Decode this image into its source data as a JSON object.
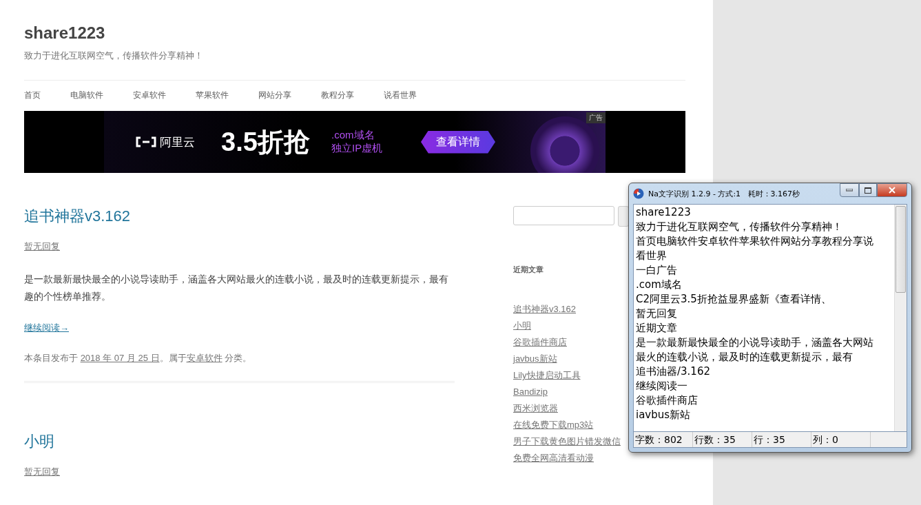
{
  "site": {
    "title": "share1223",
    "tagline": "致力于进化互联网空气，传播软件分享精神！"
  },
  "nav": [
    "首页",
    "电脑软件",
    "安卓软件",
    "苹果软件",
    "网站分享",
    "教程分享",
    "说看世界"
  ],
  "ad": {
    "brand": "阿里云",
    "headline": "3.5折抢",
    "line_1": ".com域名",
    "line_2": "独立IP虚机",
    "button": "查看详情",
    "badge": "广告"
  },
  "posts": [
    {
      "title": "追书神器v3.162",
      "replies": "暂无回复",
      "excerpt": "是一款最新最快最全的小说导读助手，涵盖各大网站最火的连载小说，最及时的连载更新提示，最有趣的个性榜单推荐。",
      "more": "继续阅读→",
      "meta": {
        "prefix": "本条目发布于",
        "date": "2018 年 07 月 25 日",
        "middle": "。属于",
        "category": "安卓软件",
        "suffix": " 分类。"
      }
    },
    {
      "title": "小明",
      "replies": "暂无回复"
    }
  ],
  "sidebar": {
    "heading": "近期文章",
    "links": [
      "追书神器v3.162",
      "小明",
      "谷歌插件商店",
      "javbus新站",
      "Lily快捷启动工具",
      "Bandizip",
      "西米浏览器",
      "在线免费下载mp3站",
      "男子下载黄色图片错发微信",
      "免费全网高清看动漫"
    ]
  },
  "ocr_window": {
    "title": "Na文字识别 1.2.9 - 方式:1   耗时：3.167秒",
    "lines": [
      "share1223",
      "致力于进化互联网空气，传播软件分享精神！",
      "首页电脑软件安卓软件苹果软件网站分享教程分享说",
      "看世界",
      "一白广告",
      ".com域名",
      "C2阿里云3.5折抢益显界盛新《查看详情、",
      "暂无回复",
      "近期文章",
      "是一款最新最快最全的小说导读助手，涵盖各大网站",
      "最火的连载小说，最及时的连载更新提示，最有",
      "追书油器/3.162",
      "继续阅读一",
      "谷歌插件商店",
      "iavbus新站"
    ],
    "status": [
      "字数：802",
      "行数：35",
      "行：35",
      "列：0"
    ]
  }
}
